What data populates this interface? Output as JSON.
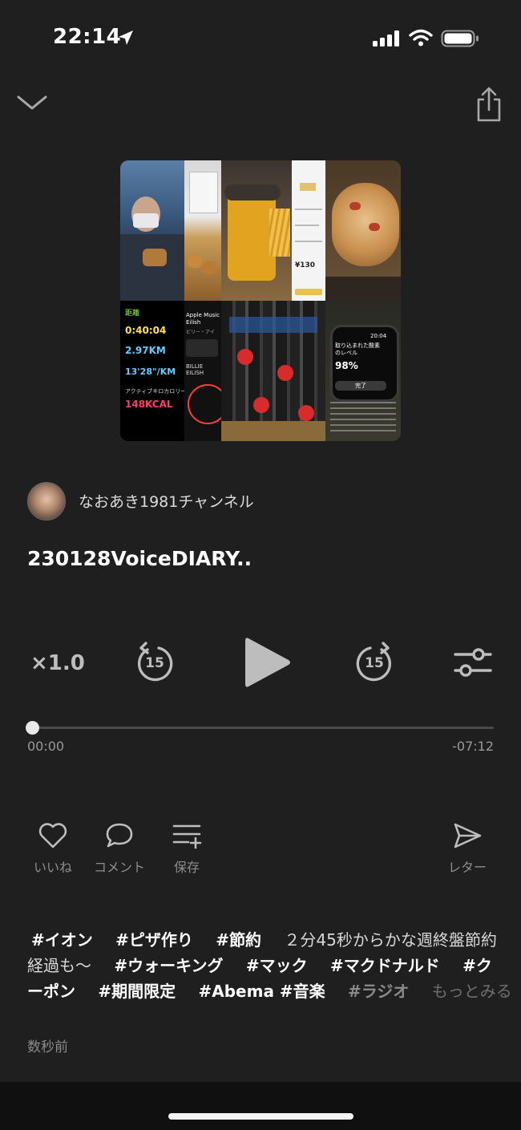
{
  "status_bar": {
    "time": "22:14"
  },
  "player": {
    "channel_name": "なおあき1981チャンネル",
    "episode_title": "230128VoiceDIARY..",
    "speed": "×1.0",
    "skip_back_seconds": "15",
    "skip_forward_seconds": "15",
    "progress": 0,
    "elapsed": "00:00",
    "remaining": "-07:12"
  },
  "artwork": {
    "texts": {
      "dist_label": "距離",
      "time_value": "0:40:04",
      "dist_value": "2.97KM",
      "pace_value": "13'28\"/KM",
      "cal_label": "アクティブキロカロリー",
      "cal_value": "148KCAL",
      "music_title": "Apple Music Eilish",
      "music_sub": "ビリー・アイ",
      "music_art": "BILLIE EILISH",
      "price_value": "¥130",
      "watch_time": "20:04",
      "watch_text": "取り込まれた酸素のレベル",
      "watch_value": "98%",
      "watch_btn": "完了"
    }
  },
  "actions": {
    "like": "いいね",
    "comment": "コメント",
    "save": "保存",
    "letter": "レター"
  },
  "description": {
    "line1": [
      {
        "type": "tag",
        "text": "#イオン"
      },
      {
        "type": "tag",
        "text": "#ピザ作り"
      },
      {
        "type": "tag",
        "text": "#節約"
      },
      {
        "type": "text",
        "text": "２分45秒からかな週終盤節約"
      }
    ],
    "line2": [
      {
        "type": "text",
        "text": "経過も〜"
      },
      {
        "type": "tag",
        "text": "#ウォーキング"
      },
      {
        "type": "tag",
        "text": "#マック"
      },
      {
        "type": "tag",
        "text": "#マクドナルド"
      },
      {
        "type": "tag",
        "text": "#ク"
      }
    ],
    "line3": [
      {
        "type": "tag",
        "text": "ーポン"
      },
      {
        "type": "tag",
        "text": "#期間限定"
      },
      {
        "type": "tag",
        "text": "#Abema #音楽"
      },
      {
        "type": "fade",
        "text": "#ラジオ"
      },
      {
        "type": "more",
        "text": "もっとみる"
      }
    ]
  },
  "posted_ago": "数秒前",
  "colors": {
    "background": "#1f1f1f",
    "text": "#ffffff",
    "muted": "#8d8d8d",
    "icon": "#bdbdbd"
  }
}
